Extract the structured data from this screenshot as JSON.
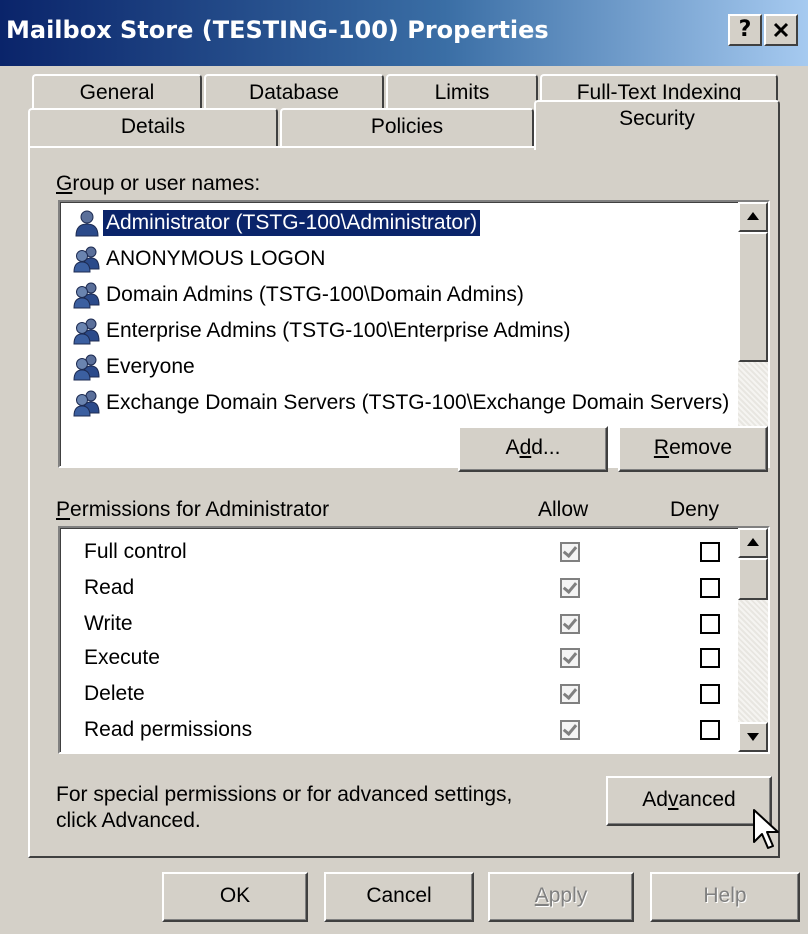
{
  "window": {
    "title": "Mailbox Store (TESTING-100) Properties",
    "help_button": "?",
    "close_button": "✕"
  },
  "tabs": {
    "row1": [
      {
        "label": "General"
      },
      {
        "label": "Database"
      },
      {
        "label": "Limits"
      },
      {
        "label": "Full-Text Indexing"
      }
    ],
    "row2": [
      {
        "label": "Details"
      },
      {
        "label": "Policies"
      },
      {
        "label": "Security",
        "active": true
      }
    ]
  },
  "users": {
    "label_first": "G",
    "label_rest": "roup or user names:",
    "items": [
      {
        "name": "Administrator (TSTG-100\\Administrator)",
        "icon": "user-icon",
        "selected": true
      },
      {
        "name": "ANONYMOUS LOGON",
        "icon": "group-icon"
      },
      {
        "name": "Domain Admins (TSTG-100\\Domain Admins)",
        "icon": "group-icon"
      },
      {
        "name": "Enterprise Admins (TSTG-100\\Enterprise Admins)",
        "icon": "group-icon"
      },
      {
        "name": "Everyone",
        "icon": "group-icon"
      },
      {
        "name": "Exchange Domain Servers (TSTG-100\\Exchange Domain Servers)",
        "icon": "group-icon"
      }
    ]
  },
  "buttons": {
    "add_pre": "A",
    "add_ul": "d",
    "add_post": "d...",
    "remove_ul": "R",
    "remove_post": "emove",
    "advanced_pre": "Ad",
    "advanced_ul": "v",
    "advanced_post": "anced",
    "ok": "OK",
    "cancel": "Cancel",
    "apply_ul": "A",
    "apply_post": "pply",
    "help": "Help"
  },
  "permissions": {
    "label_ul": "P",
    "label_rest": "ermissions for Administrator",
    "allow_header": "Allow",
    "deny_header": "Deny",
    "rows": [
      {
        "name": "Full control",
        "allow": true,
        "deny": false
      },
      {
        "name": "Read",
        "allow": true,
        "deny": false
      },
      {
        "name": "Write",
        "allow": true,
        "deny": false
      },
      {
        "name": "Execute",
        "allow": true,
        "deny": false
      },
      {
        "name": "Delete",
        "allow": true,
        "deny": false
      },
      {
        "name": "Read permissions",
        "allow": true,
        "deny": false
      }
    ]
  },
  "advanced_note": {
    "line1": "For special permissions or for advanced settings,",
    "line2": "click Advanced."
  }
}
